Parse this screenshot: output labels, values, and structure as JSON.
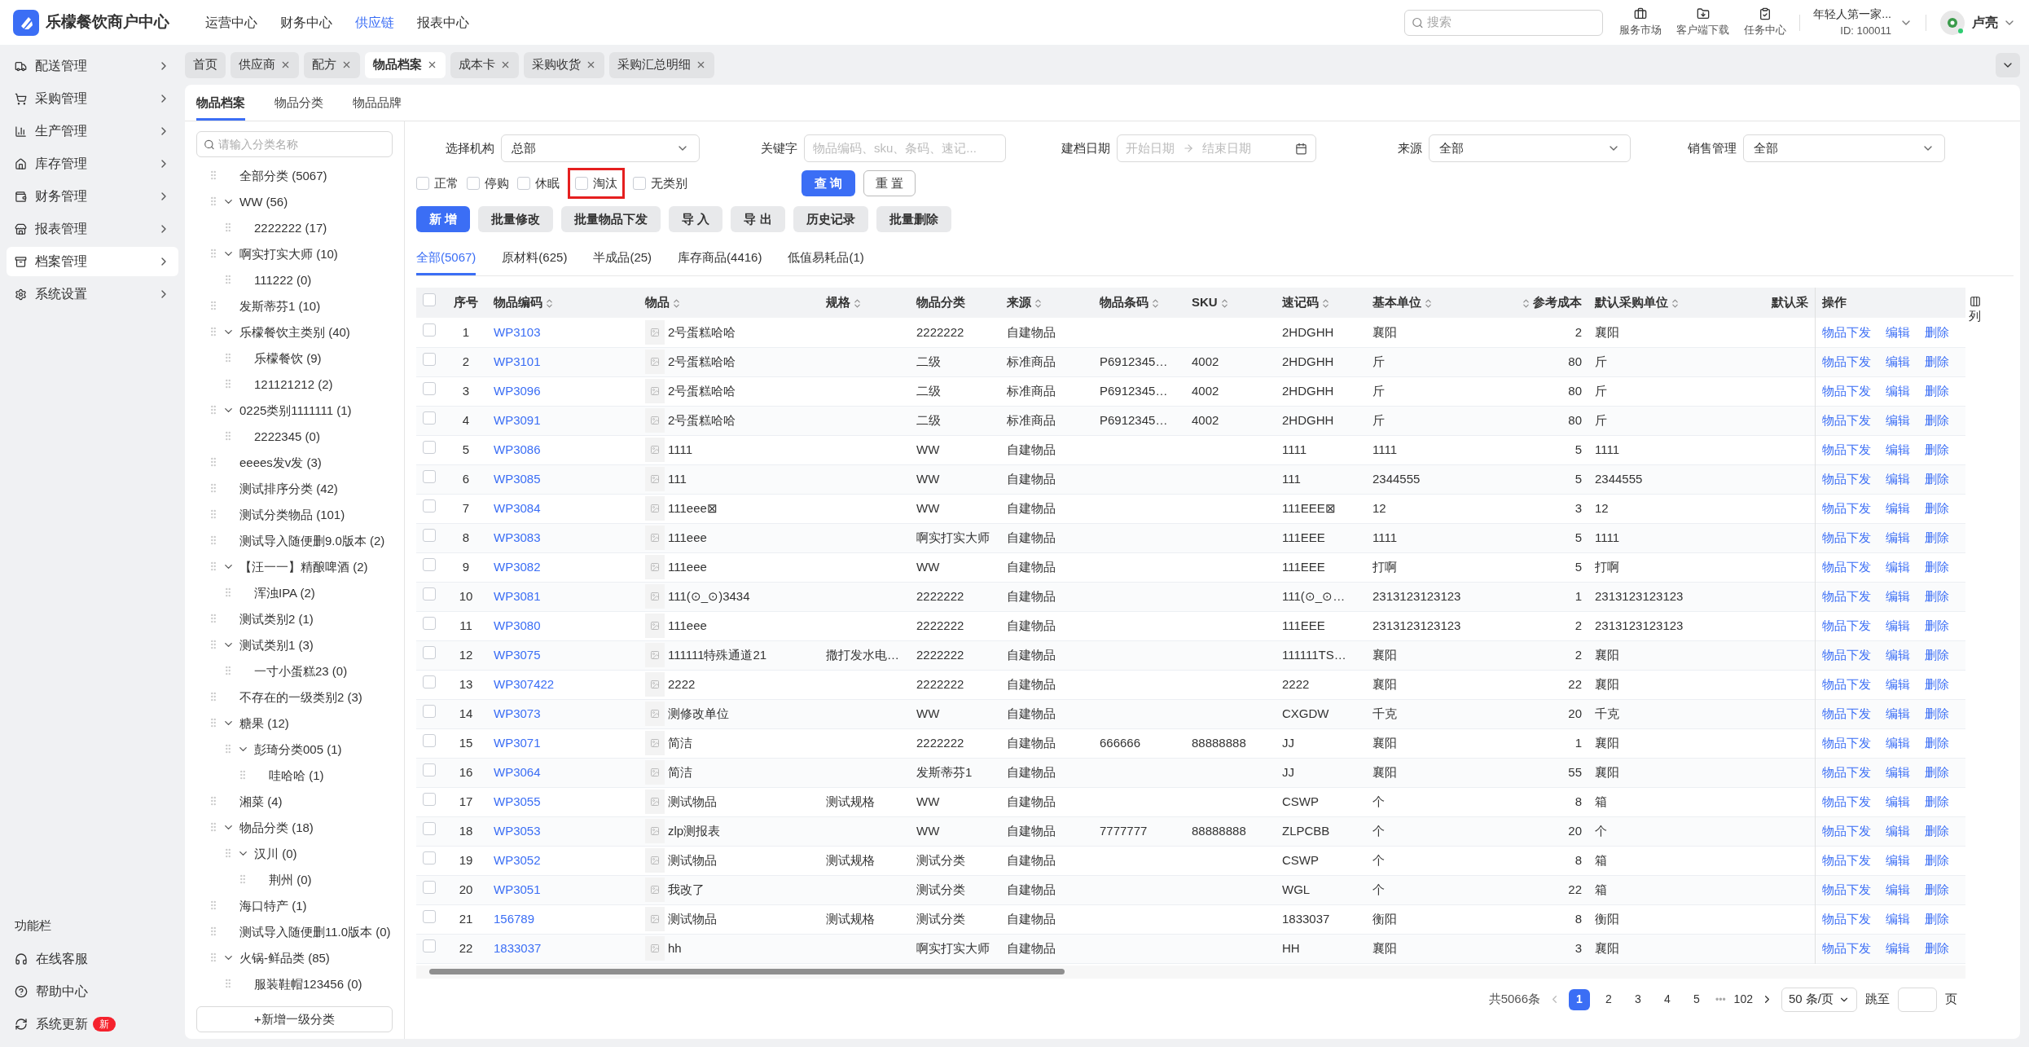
{
  "header": {
    "title": "乐檬餐饮商户中心",
    "nav": [
      {
        "label": "运营中心",
        "selected": false
      },
      {
        "label": "财务中心",
        "selected": false
      },
      {
        "label": "供应链",
        "selected": true
      },
      {
        "label": "报表中心",
        "selected": false
      }
    ],
    "search": {
      "placeholder": "搜索"
    },
    "tools": [
      "服务市场",
      "客户端下载",
      "任务中心"
    ],
    "account": {
      "name": "年轻人第一家...",
      "id": "ID: 100011"
    },
    "user": "卢亮"
  },
  "sidebar": {
    "items": [
      {
        "label": "配送管理",
        "selected": false
      },
      {
        "label": "采购管理",
        "selected": false
      },
      {
        "label": "生产管理",
        "selected": false
      },
      {
        "label": "库存管理",
        "selected": false
      },
      {
        "label": "财务管理",
        "selected": false
      },
      {
        "label": "报表管理",
        "selected": false
      },
      {
        "label": "档案管理",
        "selected": true
      },
      {
        "label": "系统设置",
        "selected": false
      }
    ],
    "footer_title": "功能栏",
    "footer_items": [
      {
        "label": "在线客服"
      },
      {
        "label": "帮助中心"
      },
      {
        "label": "系统更新",
        "badge": "新"
      }
    ]
  },
  "page_tabs": [
    {
      "label": "首页",
      "selected": false,
      "closable": false
    },
    {
      "label": "供应商",
      "selected": false,
      "closable": true
    },
    {
      "label": "配方",
      "selected": false,
      "closable": true
    },
    {
      "label": "物品档案",
      "selected": true,
      "closable": true
    },
    {
      "label": "成本卡",
      "selected": false,
      "closable": true
    },
    {
      "label": "采购收货",
      "selected": false,
      "closable": true
    },
    {
      "label": "采购汇总明细",
      "selected": false,
      "closable": true
    }
  ],
  "sub_tabs": [
    {
      "label": "物品档案",
      "selected": true
    },
    {
      "label": "物品分类",
      "selected": false
    },
    {
      "label": "物品品牌",
      "selected": false
    }
  ],
  "tree": {
    "search_placeholder": "请输入分类名称",
    "add_button": "+新增一级分类",
    "items": [
      {
        "label": "全部分类 (5067)"
      },
      {
        "label": "WW (56)",
        "expanded": true,
        "children": [
          {
            "label": "2222222 (17)"
          }
        ]
      },
      {
        "label": "啊实打实大师 (10)",
        "expanded": true,
        "children": [
          {
            "label": "111222 (0)"
          }
        ]
      },
      {
        "label": "发斯蒂芬1 (10)"
      },
      {
        "label": "乐檬餐饮主类别 (40)",
        "expanded": true,
        "children": [
          {
            "label": "乐檬餐饮 (9)"
          },
          {
            "label": "121121212 (2)"
          }
        ]
      },
      {
        "label": "0225类别1111111 (1)",
        "expanded": true,
        "children": [
          {
            "label": "2222345 (0)"
          }
        ]
      },
      {
        "label": "eeees发v发 (3)"
      },
      {
        "label": "测试排序分类 (42)"
      },
      {
        "label": "测试分类物品 (101)"
      },
      {
        "label": "测试导入随便删9.0版本 (2)"
      },
      {
        "label": "【汪一一】精酿啤酒 (2)",
        "expanded": true,
        "children": [
          {
            "label": "浑浊IPA (2)"
          }
        ]
      },
      {
        "label": "测试类别2 (1)"
      },
      {
        "label": "测试类别1 (3)",
        "expanded": true,
        "children": [
          {
            "label": "一寸小蛋糕23 (0)"
          }
        ]
      },
      {
        "label": "不存在的一级类别2 (3)"
      },
      {
        "label": "糖果 (12)",
        "expanded": true,
        "children": [
          {
            "label": "彭琦分类005 (1)",
            "expanded": true,
            "children": [
              {
                "label": "哇哈哈 (1)"
              }
            ]
          }
        ]
      },
      {
        "label": "湘菜 (4)"
      },
      {
        "label": "物品分类 (18)",
        "expanded": true,
        "children": [
          {
            "label": "汉川 (0)",
            "expanded": true,
            "children": [
              {
                "label": "荆州 (0)"
              }
            ]
          }
        ]
      },
      {
        "label": "海口特产 (1)"
      },
      {
        "label": "测试导入随便删11.0版本 (0)"
      },
      {
        "label": "火锅-鲜品类 (85)",
        "expanded": true,
        "children": [
          {
            "label": "服装鞋帽123456 (0)"
          }
        ]
      }
    ]
  },
  "filters": {
    "org": {
      "label": "选择机构",
      "value": "总部"
    },
    "keyword": {
      "label": "关键字",
      "placeholder": "物品编码、sku、条码、速记..."
    },
    "date": {
      "label": "建档日期",
      "start_placeholder": "开始日期",
      "end_placeholder": "结束日期"
    },
    "source": {
      "label": "来源",
      "value": "全部"
    },
    "sales": {
      "label": "销售管理",
      "value": "全部"
    },
    "statuses": [
      {
        "label": "正常",
        "checked": false,
        "highlighted": false
      },
      {
        "label": "停购",
        "checked": false,
        "highlighted": false
      },
      {
        "label": "休眠",
        "checked": false,
        "highlighted": false
      },
      {
        "label": "淘汰",
        "checked": false,
        "highlighted": true
      },
      {
        "label": "无类别",
        "checked": false,
        "highlighted": false
      }
    ],
    "query_button": "查 询",
    "reset_button": "重 置"
  },
  "actions": [
    {
      "label": "新 增",
      "kind": "primary"
    },
    {
      "label": "批量修改",
      "kind": "normal"
    },
    {
      "label": "批量物品下发",
      "kind": "normal"
    },
    {
      "label": "导 入",
      "kind": "normal"
    },
    {
      "label": "导 出",
      "kind": "normal"
    },
    {
      "label": "历史记录",
      "kind": "normal"
    },
    {
      "label": "批量删除",
      "kind": "normal"
    }
  ],
  "type_tabs": [
    {
      "label": "全部(5067)",
      "selected": true
    },
    {
      "label": "原材料(625)",
      "selected": false
    },
    {
      "label": "半成品(25)",
      "selected": false
    },
    {
      "label": "库存商品(4416)",
      "selected": false
    },
    {
      "label": "低值易耗品(1)",
      "selected": false
    }
  ],
  "table": {
    "select_all": {
      "checked": false
    },
    "column_settings": "列",
    "columns": [
      {
        "label": "序号",
        "sortable": false
      },
      {
        "label": "物品编码",
        "sortable": true
      },
      {
        "label": "物品",
        "sortable": true
      },
      {
        "label": "规格",
        "sortable": true
      },
      {
        "label": "物品分类",
        "sortable": false
      },
      {
        "label": "来源",
        "sortable": true
      },
      {
        "label": "物品条码",
        "sortable": true
      },
      {
        "label": "SKU",
        "sortable": true
      },
      {
        "label": "速记码",
        "sortable": true
      },
      {
        "label": "基本单位",
        "sortable": true
      },
      {
        "label": "参考成本",
        "sortable": true
      },
      {
        "label": "默认采购单位",
        "sortable": true
      },
      {
        "label": "默认采",
        "sortable": false
      },
      {
        "label": "操作",
        "sortable": false
      }
    ],
    "rows": [
      {
        "selected": false,
        "no": "1",
        "code": "WP3103",
        "name": "2号蛋糕哈哈",
        "category": "2222222",
        "source": "自建物品",
        "shortcode": "2HDGHH",
        "unit": "襄阳",
        "cost": "2",
        "purchase_unit": "襄阳",
        "actions": [
          "物品下发",
          "编辑",
          "删除"
        ]
      },
      {
        "selected": false,
        "no": "2",
        "code": "WP3101",
        "name": "2号蛋糕哈哈",
        "category": "二级",
        "source": "标准商品",
        "barcode": "P6912345…",
        "sku": "4002",
        "shortcode": "2HDGHH",
        "unit": "斤",
        "cost": "80",
        "purchase_unit": "斤",
        "actions": [
          "物品下发",
          "编辑",
          "删除"
        ]
      },
      {
        "selected": false,
        "no": "3",
        "code": "WP3096",
        "name": "2号蛋糕哈哈",
        "category": "二级",
        "source": "标准商品",
        "barcode": "P6912345…",
        "sku": "4002",
        "shortcode": "2HDGHH",
        "unit": "斤",
        "cost": "80",
        "purchase_unit": "斤",
        "actions": [
          "物品下发",
          "编辑",
          "删除"
        ]
      },
      {
        "selected": false,
        "no": "4",
        "code": "WP3091",
        "name": "2号蛋糕哈哈",
        "category": "二级",
        "source": "标准商品",
        "barcode": "P6912345…",
        "sku": "4002",
        "shortcode": "2HDGHH",
        "unit": "斤",
        "cost": "80",
        "purchase_unit": "斤",
        "actions": [
          "物品下发",
          "编辑",
          "删除"
        ]
      },
      {
        "selected": false,
        "no": "5",
        "code": "WP3086",
        "name": "1111",
        "category": "WW",
        "source": "自建物品",
        "shortcode": "1111",
        "unit": "1111",
        "cost": "5",
        "purchase_unit": "1111",
        "actions": [
          "物品下发",
          "编辑",
          "删除"
        ]
      },
      {
        "selected": false,
        "no": "6",
        "code": "WP3085",
        "name": "111",
        "category": "WW",
        "source": "自建物品",
        "shortcode": "111",
        "unit": "2344555",
        "cost": "5",
        "purchase_unit": "2344555",
        "actions": [
          "物品下发",
          "编辑",
          "删除"
        ]
      },
      {
        "selected": false,
        "no": "7",
        "code": "WP3084",
        "name": "111eee⊠",
        "category": "WW",
        "source": "自建物品",
        "shortcode": "111EEE⊠",
        "unit": "12",
        "cost": "3",
        "purchase_unit": "12",
        "actions": [
          "物品下发",
          "编辑",
          "删除"
        ]
      },
      {
        "selected": false,
        "no": "8",
        "code": "WP3083",
        "name": "111eee",
        "category": "啊实打实大师",
        "source": "自建物品",
        "shortcode": "111EEE",
        "unit": "1111",
        "cost": "5",
        "purchase_unit": "1111",
        "actions": [
          "物品下发",
          "编辑",
          "删除"
        ]
      },
      {
        "selected": false,
        "no": "9",
        "code": "WP3082",
        "name": "111eee",
        "category": "WW",
        "source": "自建物品",
        "shortcode": "111EEE",
        "unit": "打啊",
        "cost": "5",
        "purchase_unit": "打啊",
        "actions": [
          "物品下发",
          "编辑",
          "删除"
        ]
      },
      {
        "selected": false,
        "no": "10",
        "code": "WP3081",
        "name": "111(⊙_⊙)3434",
        "category": "2222222",
        "source": "自建物品",
        "shortcode": "111(⊙_⊙…",
        "unit": "2313123123123",
        "cost": "1",
        "purchase_unit": "2313123123123",
        "actions": [
          "物品下发",
          "编辑",
          "删除"
        ]
      },
      {
        "selected": false,
        "no": "11",
        "code": "WP3080",
        "name": "111eee",
        "category": "2222222",
        "source": "自建物品",
        "shortcode": "111EEE",
        "unit": "2313123123123",
        "cost": "2",
        "purchase_unit": "2313123123123",
        "actions": [
          "物品下发",
          "编辑",
          "删除"
        ]
      },
      {
        "selected": false,
        "no": "12",
        "code": "WP3075",
        "name": "111111特殊通道21",
        "spec": "撒打发水电…",
        "category": "2222222",
        "source": "自建物品",
        "shortcode": "111111TS…",
        "unit": "襄阳",
        "cost": "2",
        "purchase_unit": "襄阳",
        "actions": [
          "物品下发",
          "编辑",
          "删除"
        ]
      },
      {
        "selected": false,
        "no": "13",
        "code": "WP307422",
        "name": "2222",
        "category": "2222222",
        "source": "自建物品",
        "shortcode": "2222",
        "unit": "襄阳",
        "cost": "22",
        "purchase_unit": "襄阳",
        "actions": [
          "物品下发",
          "编辑",
          "删除"
        ]
      },
      {
        "selected": false,
        "no": "14",
        "code": "WP3073",
        "name": "测修改单位",
        "category": "WW",
        "source": "自建物品",
        "shortcode": "CXGDW",
        "unit": "千克",
        "cost": "20",
        "purchase_unit": "千克",
        "actions": [
          "物品下发",
          "编辑",
          "删除"
        ]
      },
      {
        "selected": false,
        "no": "15",
        "code": "WP3071",
        "name": "简洁",
        "category": "2222222",
        "source": "自建物品",
        "barcode": "666666",
        "sku": "88888888",
        "shortcode": "JJ",
        "unit": "襄阳",
        "cost": "1",
        "purchase_unit": "襄阳",
        "actions": [
          "物品下发",
          "编辑",
          "删除"
        ]
      },
      {
        "selected": false,
        "no": "16",
        "code": "WP3064",
        "name": "简洁",
        "category": "发斯蒂芬1",
        "source": "自建物品",
        "shortcode": "JJ",
        "unit": "襄阳",
        "cost": "55",
        "purchase_unit": "襄阳",
        "actions": [
          "物品下发",
          "编辑",
          "删除"
        ]
      },
      {
        "selected": false,
        "no": "17",
        "code": "WP3055",
        "name": "测试物品",
        "spec": "测试规格",
        "category": "WW",
        "source": "自建物品",
        "shortcode": "CSWP",
        "unit": "个",
        "cost": "8",
        "purchase_unit": "箱",
        "actions": [
          "物品下发",
          "编辑",
          "删除"
        ]
      },
      {
        "selected": false,
        "no": "18",
        "code": "WP3053",
        "name": "zlp测报表",
        "category": "WW",
        "source": "自建物品",
        "barcode": "7777777",
        "sku": "88888888",
        "shortcode": "ZLPCBB",
        "unit": "个",
        "cost": "20",
        "purchase_unit": "个",
        "actions": [
          "物品下发",
          "编辑",
          "删除"
        ]
      },
      {
        "selected": false,
        "no": "19",
        "code": "WP3052",
        "name": "测试物品",
        "spec": "测试规格",
        "category": "测试分类",
        "source": "自建物品",
        "shortcode": "CSWP",
        "unit": "个",
        "cost": "8",
        "purchase_unit": "箱",
        "actions": [
          "物品下发",
          "编辑",
          "删除"
        ]
      },
      {
        "selected": false,
        "no": "20",
        "code": "WP3051",
        "name": "我改了",
        "category": "测试分类",
        "source": "自建物品",
        "shortcode": "WGL",
        "unit": "个",
        "cost": "22",
        "purchase_unit": "箱",
        "actions": [
          "物品下发",
          "编辑",
          "删除"
        ]
      },
      {
        "selected": false,
        "no": "21",
        "code": "156789",
        "name": "测试物品",
        "spec": "测试规格",
        "category": "测试分类",
        "source": "自建物品",
        "shortcode": "1833037",
        "unit": "衡阳",
        "cost": "8",
        "purchase_unit": "衡阳",
        "actions": [
          "物品下发",
          "编辑",
          "删除"
        ]
      },
      {
        "selected": false,
        "no": "22",
        "code": "1833037",
        "name": "hh",
        "category": "啊实打实大师",
        "source": "自建物品",
        "shortcode": "HH",
        "unit": "襄阳",
        "cost": "3",
        "purchase_unit": "襄阳",
        "actions": [
          "物品下发",
          "编辑",
          "删除"
        ]
      }
    ]
  },
  "pagination": {
    "total": "共5066条",
    "pages": [
      {
        "label": "1",
        "selected": true
      },
      {
        "label": "2",
        "selected": false
      },
      {
        "label": "3",
        "selected": false
      },
      {
        "label": "4",
        "selected": false
      },
      {
        "label": "5",
        "selected": false
      }
    ],
    "ellipsis": "•••",
    "last_page": "102",
    "page_size": "50 条/页",
    "jump_label": "跳至",
    "page_suffix": "页"
  }
}
